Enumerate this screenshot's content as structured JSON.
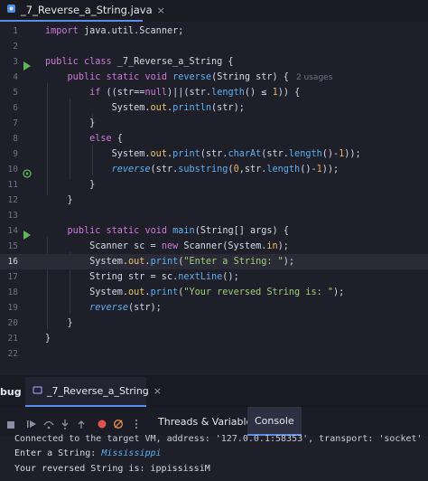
{
  "editor_tab": {
    "filename": "_7_Reverse_a_String.java",
    "close": "×"
  },
  "line_numbers": [
    "1",
    "2",
    "3",
    "4",
    "5",
    "6",
    "7",
    "8",
    "9",
    "10",
    "11",
    "12",
    "13",
    "14",
    "15",
    "16",
    "17",
    "18",
    "19",
    "20",
    "21",
    "22"
  ],
  "code": {
    "l1_kw": "import",
    "l1_rest": " java.util.Scanner;",
    "l3_kw1": "public",
    "l3_kw2": "class",
    "l3_name": " _7_Reverse_a_String {",
    "l4_kw1": "public",
    "l4_kw2": "static",
    "l4_kw3": "void",
    "l4_fn": "reverse",
    "l4_rest": "(String str) {",
    "l4_usage": "2 usages",
    "l5_kw1": "if",
    "l5_a": " ((str==",
    "l5_kw2": "null",
    "l5_b": ")||(str.",
    "l5_fn": "length",
    "l5_c": "() ",
    "l5_op": "≤",
    "l5_num": "1",
    "l5_d": ")) {",
    "l6_a": "System.",
    "l6_fld": "out",
    "l6_b": ".",
    "l6_fn": "println",
    "l6_c": "(str);",
    "l7": "}",
    "l8_kw": "else",
    "l8_rest": " {",
    "l9_a": "System.",
    "l9_fld": "out",
    "l9_b": ".",
    "l9_fn": "print",
    "l9_c": "(str.",
    "l9_fn2": "charAt",
    "l9_d": "(str.",
    "l9_fn3": "length",
    "l9_e": "()-",
    "l9_num": "1",
    "l9_f": "));",
    "l10_it": "reverse",
    "l10_a": "(str.",
    "l10_fn": "substring",
    "l10_b": "(",
    "l10_num": "0",
    "l10_c": ",str.",
    "l10_fn2": "length",
    "l10_d": "()-",
    "l10_num2": "1",
    "l10_e": "));",
    "l11": "}",
    "l12": "}",
    "l14_kw1": "public",
    "l14_kw2": "static",
    "l14_kw3": "void",
    "l14_fn": "main",
    "l14_rest": "(String[] args) {",
    "l15_a": "Scanner sc = ",
    "l15_kw": "new",
    "l15_b": " Scanner(System.",
    "l15_fld": "in",
    "l15_c": ");",
    "l16_a": "System.",
    "l16_fld": "out",
    "l16_b": ".",
    "l16_fn": "print",
    "l16_c": "(",
    "l16_str": "\"Enter a String: \"",
    "l16_d": ");",
    "l17_a": "String str = sc.",
    "l17_fn": "nextLine",
    "l17_b": "();",
    "l18_a": "System.",
    "l18_fld": "out",
    "l18_b": ".",
    "l18_fn": "print",
    "l18_c": "(",
    "l18_str": "\"Your reversed String is: \"",
    "l18_d": ");",
    "l19_it": "reverse",
    "l19_a": "(str);",
    "l20": "}",
    "l21": "}"
  },
  "debug_panel": {
    "label": "bug",
    "session_tab": "_7_Reverse_a_String",
    "close": "×",
    "tabs": [
      "Threads & Variables",
      "Console"
    ],
    "active_tab": "Console"
  },
  "console": {
    "line1": "Connected to the target VM, address: '127.0.0.1:58353', transport: 'socket'",
    "line2_prompt": "Enter a String: ",
    "line2_input": "Mississippi",
    "line3": "Your reversed String is: ippississiM"
  },
  "colors": {
    "keyword": "#cc7bd6",
    "function": "#5eb0ef",
    "string": "#9fd07a",
    "number": "#e6a96b",
    "field": "#eac66d",
    "accent": "#5a8de8"
  }
}
